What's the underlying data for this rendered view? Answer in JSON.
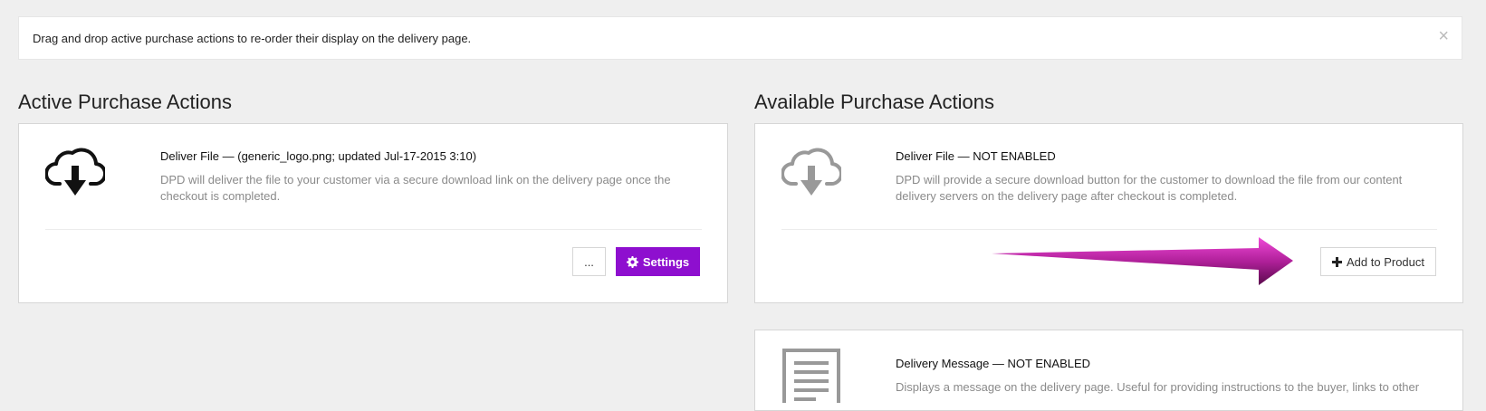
{
  "notice": {
    "text": "Drag and drop active purchase actions to re-order their display on the delivery page.",
    "close_glyph": "×"
  },
  "active": {
    "heading": "Active Purchase Actions",
    "items": [
      {
        "icon": "cloud-download-icon",
        "title": "Deliver File — (generic_logo.png; updated Jul-17-2015 3:10)",
        "description_line1": "DPD will deliver the file to your customer via a secure download link on the delivery page once the",
        "description_line2": "checkout is completed.",
        "more_label": "...",
        "settings_label": "Settings"
      }
    ]
  },
  "available": {
    "heading": "Available Purchase Actions",
    "items": [
      {
        "icon": "cloud-download-icon",
        "title": "Deliver File — NOT ENABLED",
        "description_line1": "DPD will provide a secure download button for the customer to download the file from our content",
        "description_line2": "delivery servers on the delivery page after checkout is completed.",
        "add_label": "Add to Product"
      },
      {
        "icon": "document-icon",
        "title": "Delivery Message — NOT ENABLED",
        "description_line1": "Displays a message on the delivery page. Useful for providing instructions to the buyer, links to other"
      }
    ]
  },
  "colors": {
    "primary_button": "#8e0fcf",
    "arrow": "#b0209a"
  }
}
